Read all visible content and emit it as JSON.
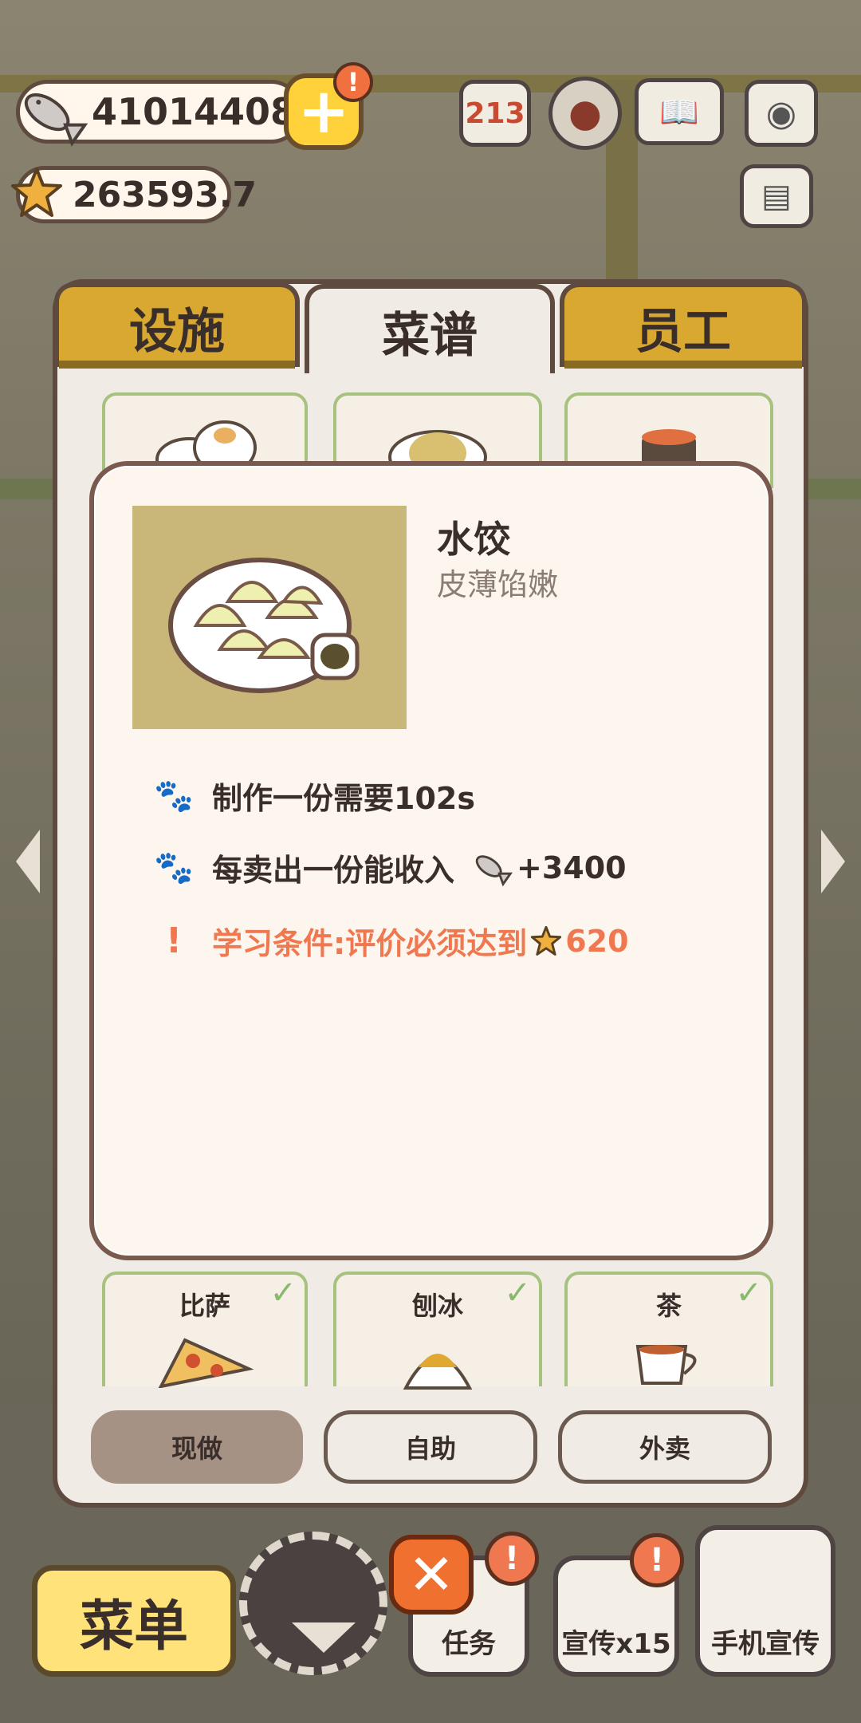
{
  "currency": {
    "fish": "410144089",
    "stars": "263593.7",
    "add_alert": "!"
  },
  "tabs": [
    {
      "label": "设施"
    },
    {
      "label": "菜谱"
    },
    {
      "label": "员工"
    }
  ],
  "active_tab": "菜谱",
  "recipe_detail": {
    "name": "水饺",
    "description": "皮薄馅嫩",
    "time_text": "制作一份需要102s",
    "income_text": "每卖出一份能收入",
    "income_value": "+3400",
    "requirement_text": "学习条件:评价必须达到",
    "requirement_value": "620",
    "requirement_mark": "!"
  },
  "recipe_cards_bottom": [
    {
      "label": "比萨",
      "learned": true
    },
    {
      "label": "刨冰",
      "learned": true
    },
    {
      "label": "茶",
      "learned": true
    }
  ],
  "modes": [
    {
      "label": "现做",
      "selected": true
    },
    {
      "label": "自助",
      "selected": false
    },
    {
      "label": "外卖",
      "selected": false
    }
  ],
  "bottom_bar": {
    "menu_label": "菜单",
    "task_label": "任务",
    "promo_label": "宣传x15",
    "phone_promo_label": "手机宣传",
    "close_symbol": "✕",
    "alert_mark": "!"
  },
  "colors": {
    "tab_inactive": "#d8a830",
    "requirement": "#f07850",
    "popup_bg": "#fdf6ee"
  }
}
